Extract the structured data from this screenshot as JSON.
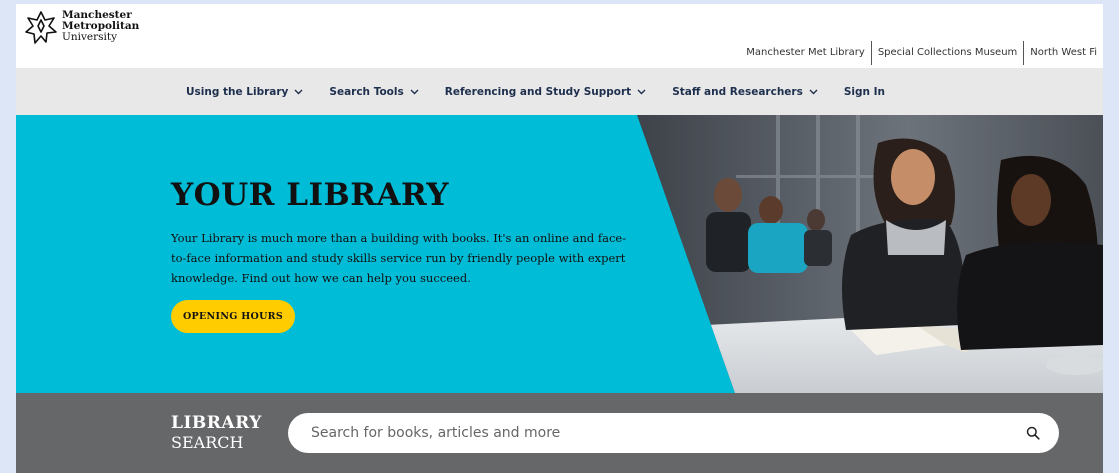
{
  "brand": {
    "name_line1": "Manchester",
    "name_line2": "Metropolitan",
    "name_line3": "University"
  },
  "utility_links": [
    {
      "label": "Manchester Met Library"
    },
    {
      "label": "Special Collections Museum"
    },
    {
      "label": "North West Fi"
    }
  ],
  "nav": {
    "items": [
      {
        "label": "Using the Library",
        "has_dropdown": true
      },
      {
        "label": "Search Tools",
        "has_dropdown": true
      },
      {
        "label": "Referencing and Study Support",
        "has_dropdown": true
      },
      {
        "label": "Staff and Researchers",
        "has_dropdown": true
      },
      {
        "label": "Sign In",
        "has_dropdown": false
      }
    ]
  },
  "hero": {
    "title": "YOUR LIBRARY",
    "description": "Your Library is much more than a building with books. It's an online and face-to-face information and study skills service run by friendly people with expert knowledge. Find out how we can help you succeed.",
    "button_label": "OPENING HOURS"
  },
  "search": {
    "logo_line1": "LIBRARY",
    "logo_line2": "SEARCH",
    "placeholder": "Search for books, articles and more",
    "icon": "search-icon"
  },
  "colors": {
    "hero_bg": "#00bcd6",
    "button": "#ffcc00",
    "nav_bg": "#e8e8e8",
    "nav_text": "#1d2f4d",
    "search_band": "#666769"
  }
}
